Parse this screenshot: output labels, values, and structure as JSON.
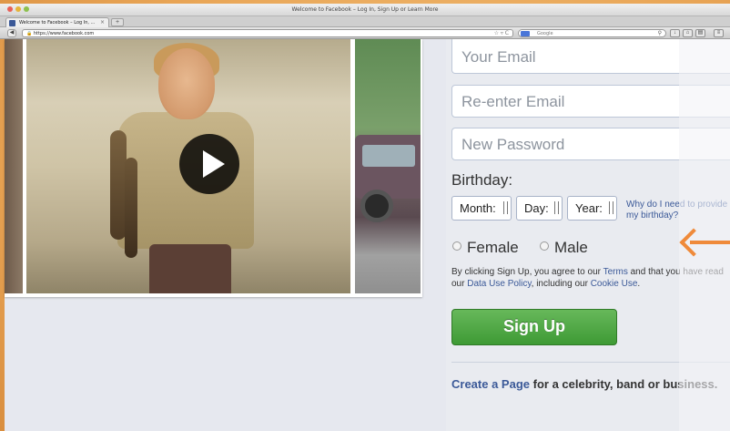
{
  "window": {
    "title": "Welcome to Facebook – Log In, Sign Up or Learn More"
  },
  "tab": {
    "label": "Welcome to Facebook – Log In, ..."
  },
  "address_bar": {
    "url": "https://www.facebook.com"
  },
  "search_bar": {
    "placeholder": "Google"
  },
  "signup": {
    "email_placeholder": "Your Email",
    "reenter_email_placeholder": "Re-enter Email",
    "password_placeholder": "New Password",
    "birthday_label": "Birthday:",
    "month_label": "Month:",
    "day_label": "Day:",
    "year_label": "Year:",
    "why_link": "Why do I need to provide my birthday?",
    "gender_female": "Female",
    "gender_male": "Male",
    "terms_prefix": "By clicking Sign Up, you agree to our",
    "terms_link": "Terms",
    "terms_mid": "and that you have read our",
    "data_policy_link": "Data Use Policy",
    "terms_mid2": ", including our",
    "cookie_link": "Cookie Use",
    "terms_end": ".",
    "signup_button": "Sign Up",
    "create_page_link": "Create a Page",
    "create_page_rest": "for a celebrity, band or business."
  },
  "colors": {
    "facebook_blue": "#3b5998",
    "signup_green": "#4aa63f",
    "annotation_arrow": "#ef8a3a"
  }
}
